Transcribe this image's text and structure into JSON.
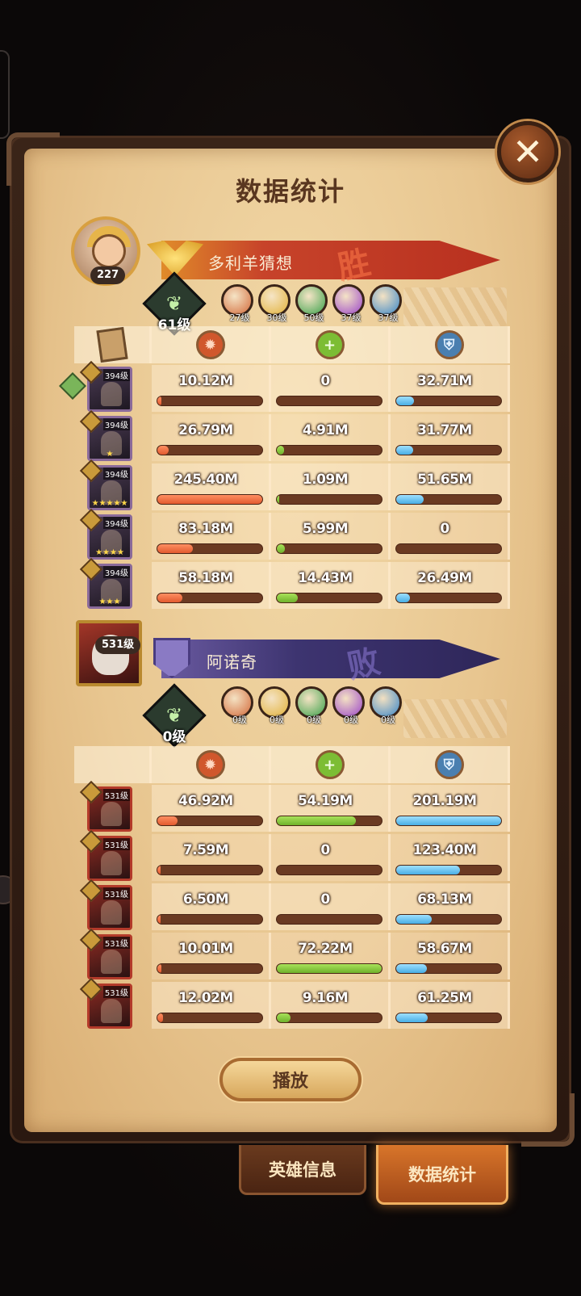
{
  "title": "数据统计",
  "close_label": "✕",
  "winner": {
    "name": "多利羊猜想",
    "result": "胜",
    "avatar_level": "227",
    "tree_level": "61级",
    "factions": [
      {
        "label": "27级",
        "color": "#d36a3a"
      },
      {
        "label": "30级",
        "color": "#e2b23a"
      },
      {
        "label": "50级",
        "color": "#3aa14a"
      },
      {
        "label": "37级",
        "color": "#9b45c9"
      },
      {
        "label": "37级",
        "color": "#3a87c9"
      }
    ],
    "heroes": [
      {
        "level": "394级",
        "stars": "",
        "damage": "10.12M",
        "damage_pct": 0.04,
        "heal": "0",
        "heal_pct": 0,
        "defense": "32.71M",
        "defense_pct": 0.17
      },
      {
        "level": "394级",
        "stars": "★",
        "damage": "26.79M",
        "damage_pct": 0.11,
        "heal": "4.91M",
        "heal_pct": 0.07,
        "defense": "31.77M",
        "defense_pct": 0.16
      },
      {
        "level": "394级",
        "stars": "★★★★★",
        "damage": "245.40M",
        "damage_pct": 1.0,
        "heal": "1.09M",
        "heal_pct": 0.02,
        "defense": "51.65M",
        "defense_pct": 0.26
      },
      {
        "level": "394级",
        "stars": "★★★★",
        "damage": "83.18M",
        "damage_pct": 0.34,
        "heal": "5.99M",
        "heal_pct": 0.08,
        "defense": "0",
        "defense_pct": 0
      },
      {
        "level": "394级",
        "stars": "★★★",
        "damage": "58.18M",
        "damage_pct": 0.24,
        "heal": "14.43M",
        "heal_pct": 0.2,
        "defense": "26.49M",
        "defense_pct": 0.13
      }
    ]
  },
  "loser": {
    "name": "阿诺奇",
    "result": "败",
    "avatar_level": "531级",
    "tree_level": "0级",
    "factions": [
      {
        "label": "0级",
        "color": "#d36a3a"
      },
      {
        "label": "0级",
        "color": "#e2b23a"
      },
      {
        "label": "0级",
        "color": "#3aa14a"
      },
      {
        "label": "0级",
        "color": "#9b45c9"
      },
      {
        "label": "0级",
        "color": "#3a87c9"
      }
    ],
    "heroes": [
      {
        "level": "531级",
        "damage": "46.92M",
        "damage_pct": 0.19,
        "heal": "54.19M",
        "heal_pct": 0.75,
        "defense": "201.19M",
        "defense_pct": 1.0
      },
      {
        "level": "531级",
        "damage": "7.59M",
        "damage_pct": 0.03,
        "heal": "0",
        "heal_pct": 0,
        "defense": "123.40M",
        "defense_pct": 0.61
      },
      {
        "level": "531级",
        "damage": "6.50M",
        "damage_pct": 0.03,
        "heal": "0",
        "heal_pct": 0,
        "defense": "68.13M",
        "defense_pct": 0.34
      },
      {
        "level": "531级",
        "damage": "10.01M",
        "damage_pct": 0.04,
        "heal": "72.22M",
        "heal_pct": 1.0,
        "defense": "58.67M",
        "defense_pct": 0.29
      },
      {
        "level": "531级",
        "damage": "12.02M",
        "damage_pct": 0.05,
        "heal": "9.16M",
        "heal_pct": 0.13,
        "defense": "61.25M",
        "defense_pct": 0.3
      }
    ]
  },
  "columns": [
    {
      "icon": "damage-icon",
      "glyph": "✹"
    },
    {
      "icon": "heal-icon",
      "glyph": "+"
    },
    {
      "icon": "defense-icon",
      "glyph": "⛨"
    }
  ],
  "play_label": "播放",
  "tabs": {
    "hero_info": "英雄信息",
    "stats": "数据统计"
  }
}
